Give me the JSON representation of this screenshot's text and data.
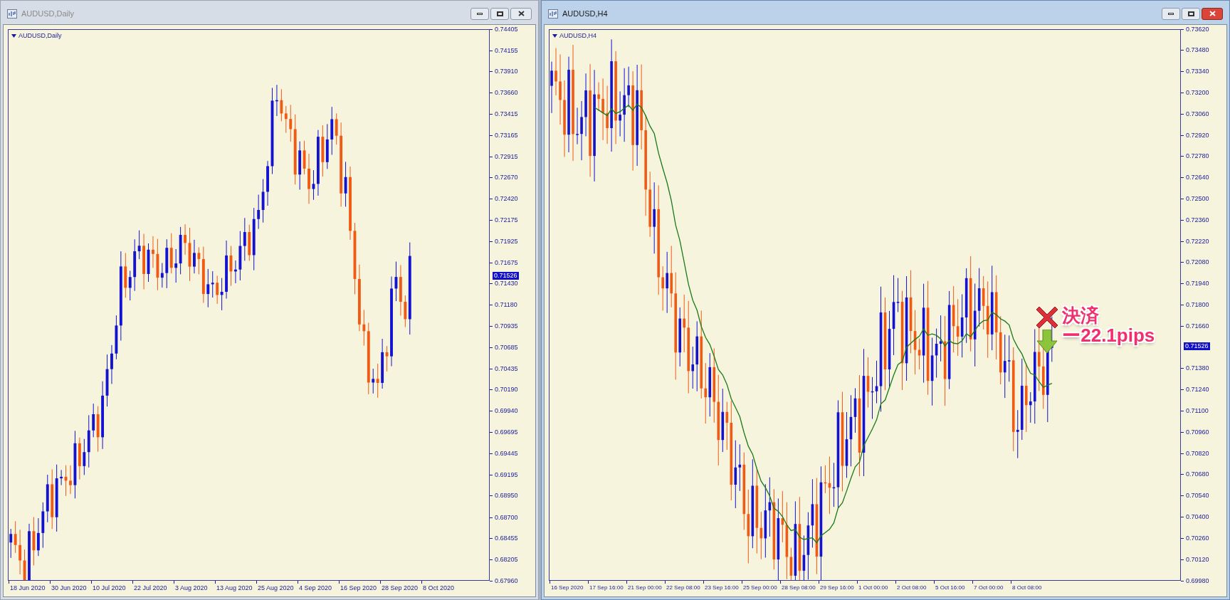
{
  "windows": [
    {
      "title": "AUDUSD,Daily",
      "active": false,
      "kind": "daily",
      "symbol_label": "AUDUSD,Daily",
      "moving_average": false,
      "price_tag": "0.71526",
      "y_ticks": [
        "0.74405",
        "0.74155",
        "0.73910",
        "0.73660",
        "0.73415",
        "0.73165",
        "0.72915",
        "0.72670",
        "0.72420",
        "0.72175",
        "0.71925",
        "0.71675",
        "0.71430",
        "0.71180",
        "0.70935",
        "0.70685",
        "0.70435",
        "0.70190",
        "0.69940",
        "0.69695",
        "0.69445",
        "0.69195",
        "0.68950",
        "0.68700",
        "0.68455",
        "0.68205",
        "0.67960"
      ],
      "x_ticks": [
        "18 Jun 2020",
        "30 Jun 2020",
        "10 Jul 2020",
        "22 Jul 2020",
        "3 Aug 2020",
        "13 Aug 2020",
        "25 Aug 2020",
        "4 Sep 2020",
        "16 Sep 2020",
        "28 Sep 2020",
        "8 Oct 2020"
      ]
    },
    {
      "title": "AUDUSD,H4",
      "active": true,
      "kind": "h4",
      "symbol_label": "AUDUSD,H4",
      "moving_average": true,
      "price_tag": "0.71526",
      "y_ticks": [
        "0.73620",
        "0.73480",
        "0.73340",
        "0.73200",
        "0.73060",
        "0.72920",
        "0.72780",
        "0.72640",
        "0.72500",
        "0.72360",
        "0.72220",
        "0.72080",
        "0.71940",
        "0.71800",
        "0.71660",
        "0.71380",
        "0.71240",
        "0.71100",
        "0.70960",
        "0.70820",
        "0.70680",
        "0.70540",
        "0.70400",
        "0.70260",
        "0.70120",
        "0.69980"
      ],
      "x_ticks": [
        "16 Sep 2020",
        "17 Sep 16:00",
        "21 Sep 00:00",
        "22 Sep 08:00",
        "23 Sep 16:00",
        "25 Sep 00:00",
        "28 Sep 08:00",
        "29 Sep 16:00",
        "1 Oct 00:00",
        "2 Oct 08:00",
        "5 Oct 16:00",
        "7 Oct 00:00",
        "8 Oct 08:00"
      ],
      "annotation": {
        "lines": [
          "決済",
          "ー22.1pips"
        ]
      }
    }
  ]
}
